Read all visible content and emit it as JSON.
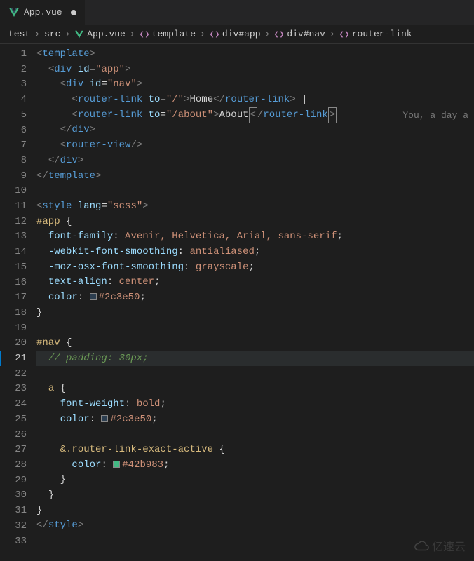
{
  "tab": {
    "filename": "App.vue",
    "icon": "vue-icon",
    "modified": true
  },
  "breadcrumb": {
    "items": [
      {
        "label": "test",
        "icon": null
      },
      {
        "label": "src",
        "icon": null
      },
      {
        "label": "App.vue",
        "icon": "vue-icon"
      },
      {
        "label": "template",
        "icon": "xml-icon"
      },
      {
        "label": "div#app",
        "icon": "xml-icon"
      },
      {
        "label": "div#nav",
        "icon": "xml-icon"
      },
      {
        "label": "router-link",
        "icon": "xml-icon"
      }
    ]
  },
  "editor": {
    "active_line": 21,
    "line_count": 33,
    "codelens_text": "You, a day a",
    "lines": {
      "1": {
        "type": "tag_open_close",
        "indent": 0,
        "tag": "template",
        "self_close": false,
        "close": false
      },
      "2": {
        "type": "tag_with_attr",
        "indent": 1,
        "tag": "div",
        "attr": "id",
        "value": "app"
      },
      "3": {
        "type": "tag_with_attr",
        "indent": 2,
        "tag": "div",
        "attr": "id",
        "value": "nav"
      },
      "4": {
        "type": "router_link",
        "indent": 3,
        "to": "/",
        "text": "Home",
        "trailing": " |"
      },
      "5": {
        "type": "router_link_boxed",
        "indent": 3,
        "to": "/about",
        "text": "About"
      },
      "6": {
        "type": "tag_close",
        "indent": 2,
        "tag": "div"
      },
      "7": {
        "type": "tag_self_close",
        "indent": 2,
        "tag": "router-view"
      },
      "8": {
        "type": "tag_close",
        "indent": 1,
        "tag": "div"
      },
      "9": {
        "type": "tag_close",
        "indent": 0,
        "tag": "template"
      },
      "10": {
        "type": "blank"
      },
      "11": {
        "type": "style_open",
        "indent": 0,
        "lang": "scss"
      },
      "12": {
        "type": "selector_open",
        "indent": 0,
        "selector": "#app"
      },
      "13": {
        "type": "css_prop",
        "indent": 1,
        "prop": "font-family",
        "val": "Avenir, Helvetica, Arial, sans-serif"
      },
      "14": {
        "type": "css_prop",
        "indent": 1,
        "prop": "-webkit-font-smoothing",
        "val": "antialiased"
      },
      "15": {
        "type": "css_prop",
        "indent": 1,
        "prop": "-moz-osx-font-smoothing",
        "val": "grayscale"
      },
      "16": {
        "type": "css_prop",
        "indent": 1,
        "prop": "text-align",
        "val": "center"
      },
      "17": {
        "type": "css_color",
        "indent": 1,
        "prop": "color",
        "hex": "#2c3e50"
      },
      "18": {
        "type": "brace_close",
        "indent": 0
      },
      "19": {
        "type": "blank"
      },
      "20": {
        "type": "selector_open",
        "indent": 0,
        "selector": "#nav"
      },
      "21": {
        "type": "comment",
        "indent": 1,
        "text": "// padding: 30px;"
      },
      "22": {
        "type": "blank"
      },
      "23": {
        "type": "selector_open",
        "indent": 1,
        "selector": "a"
      },
      "24": {
        "type": "css_prop",
        "indent": 2,
        "prop": "font-weight",
        "val": "bold"
      },
      "25": {
        "type": "css_color",
        "indent": 2,
        "prop": "color",
        "hex": "#2c3e50"
      },
      "26": {
        "type": "blank"
      },
      "27": {
        "type": "selector_amp",
        "indent": 2,
        "selector": "&.router-link-exact-active"
      },
      "28": {
        "type": "css_color",
        "indent": 3,
        "prop": "color",
        "hex": "#42b983"
      },
      "29": {
        "type": "brace_close",
        "indent": 2
      },
      "30": {
        "type": "brace_close",
        "indent": 1
      },
      "31": {
        "type": "brace_close",
        "indent": 0
      },
      "32": {
        "type": "tag_close",
        "indent": 0,
        "tag": "style"
      },
      "33": {
        "type": "blank"
      }
    }
  },
  "colors": {
    "#2c3e50": "#2c3e50",
    "#42b983": "#42b983"
  },
  "watermark": {
    "text": "亿速云"
  }
}
